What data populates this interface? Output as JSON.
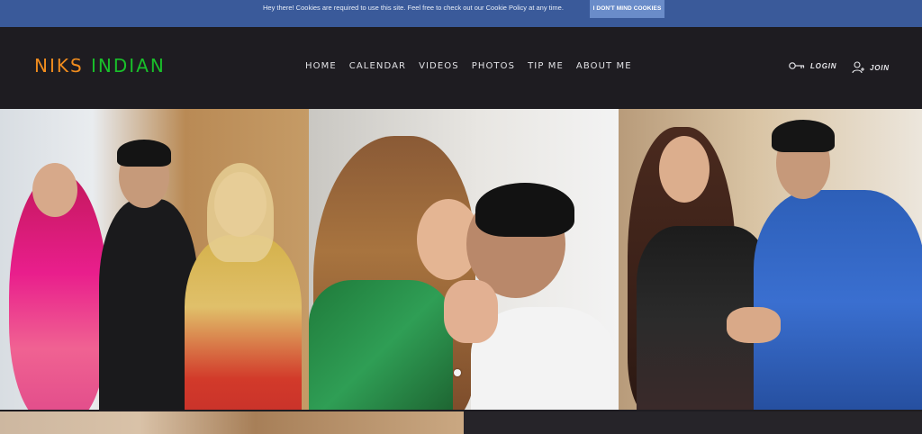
{
  "cookie_bar": {
    "message": "Hey there! Cookies are required to use this site. Feel free to check out our Cookie Policy at any time.",
    "button_label": "I DON'T MIND COOKIES"
  },
  "header": {
    "logo_word1": "NIKS",
    "logo_word2": "INDIAN",
    "nav": [
      "HOME",
      "CALENDAR",
      "VIDEOS",
      "PHOTOS",
      "TIP ME",
      "ABOUT ME"
    ],
    "login_label": "LOGIN",
    "join_label": "JOIN"
  },
  "colors": {
    "cookie_bar": "#3a5a9a",
    "header_bg": "#1e1c21",
    "logo_orange": "#f08c1e",
    "logo_green": "#19c02a"
  },
  "hero": {
    "slides": [
      "group-photo",
      "couple-kiss-photo",
      "couple-holding-hands-photo"
    ]
  }
}
